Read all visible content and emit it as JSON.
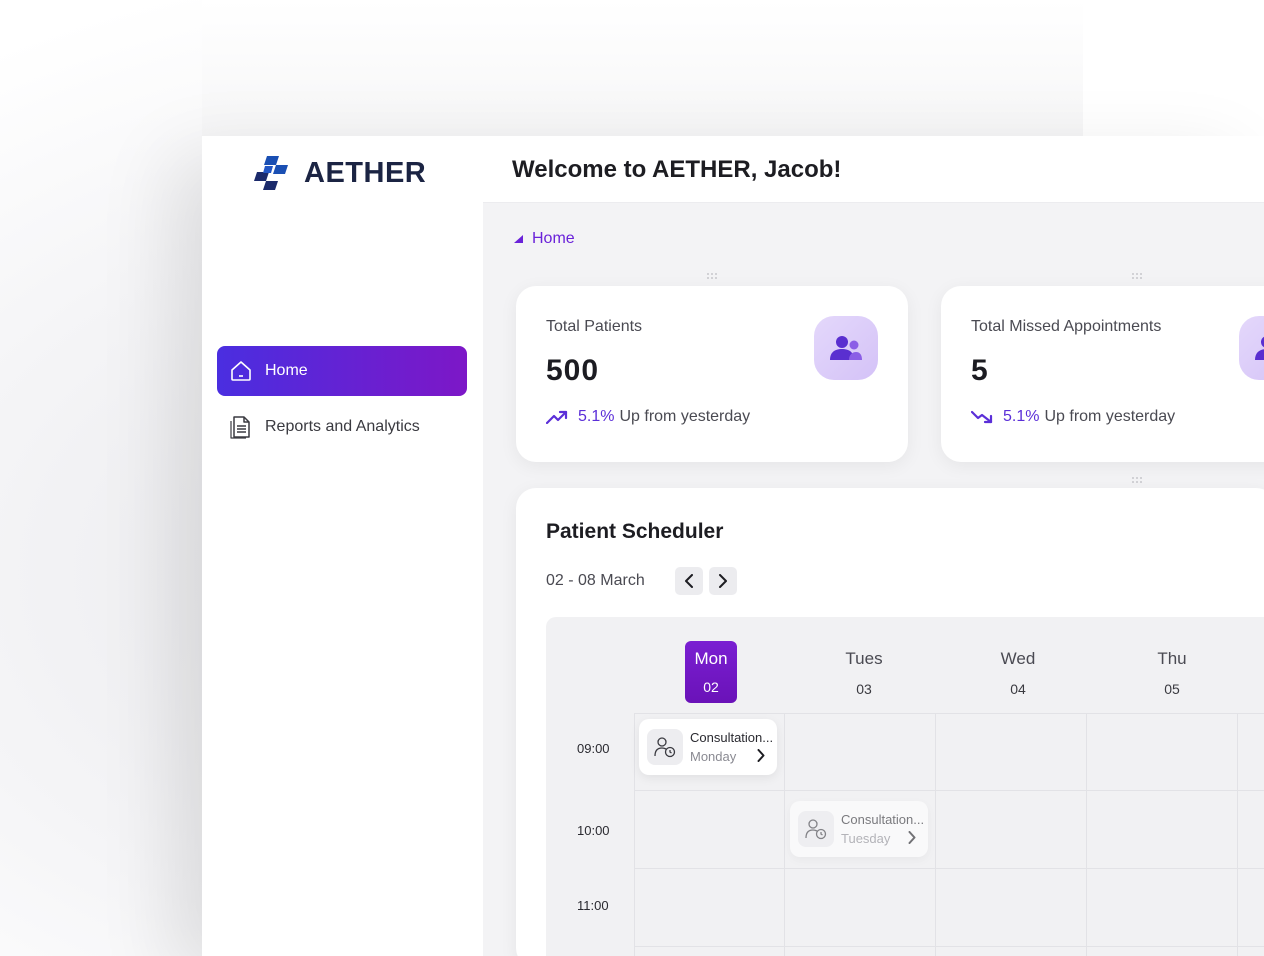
{
  "app": {
    "brand": "AETHER",
    "welcome": "Welcome to AETHER, Jacob!"
  },
  "sidebar": {
    "items": [
      {
        "label": "Home",
        "icon": "home-icon",
        "active": true
      },
      {
        "label": "Reports and Analytics",
        "icon": "document-icon",
        "active": false
      }
    ]
  },
  "breadcrumb": {
    "label": "Home"
  },
  "stats": [
    {
      "label": "Total Patients",
      "value": "500",
      "trend_pct": "5.1%",
      "trend_text": "Up from yesterday",
      "trend_icon": "trend-up-icon",
      "icon": "patients-icon"
    },
    {
      "label": "Total Missed Appointments",
      "value": "5",
      "trend_pct": "5.1%",
      "trend_text": "Up from yesterday",
      "trend_icon": "trend-down-icon",
      "icon": "user-icon"
    }
  ],
  "scheduler": {
    "title": "Patient Scheduler",
    "range": "02 - 08 March",
    "days": [
      {
        "name": "Mon",
        "num": "02",
        "active": true
      },
      {
        "name": "Tues",
        "num": "03",
        "active": false
      },
      {
        "name": "Wed",
        "num": "04",
        "active": false
      },
      {
        "name": "Thu",
        "num": "05",
        "active": false
      }
    ],
    "times": [
      "09:00",
      "10:00",
      "11:00"
    ],
    "events": [
      {
        "title": "Consultation...",
        "day": "Monday"
      },
      {
        "title": "Consultation...",
        "day": "Tuesday"
      }
    ]
  },
  "colors": {
    "accent": "#6a22d9",
    "accent_gradient_start": "#4a2ee0",
    "accent_gradient_end": "#7d17c7",
    "brand_navy": "#1b2443"
  }
}
